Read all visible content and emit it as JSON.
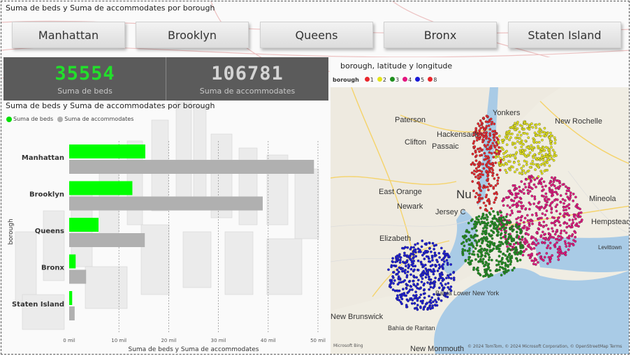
{
  "top_title": "Suma de beds y Suma de accommodates por borough",
  "slicer": {
    "items": [
      "Manhattan",
      "Brooklyn",
      "Queens",
      "Bronx",
      "Staten Island"
    ]
  },
  "kpis": [
    {
      "value": "35554",
      "label": "Suma de beds",
      "color": "#22e02b"
    },
    {
      "value": "106781",
      "label": "Suma de accommodates",
      "color": "#d0d0d0"
    }
  ],
  "bar_chart": {
    "title": "Suma de beds y Suma de accommodates por borough",
    "legend": [
      "Suma de beds",
      "Suma de accommodates"
    ]
  },
  "chart_data": {
    "type": "bar",
    "orientation": "horizontal",
    "title": "Suma de beds y Suma de accommodates por borough",
    "categories": [
      "Manhattan",
      "Brooklyn",
      "Queens",
      "Bronx",
      "Staten Island"
    ],
    "series": [
      {
        "name": "Suma de beds",
        "color": "#00ff00",
        "values": [
          15300,
          12700,
          5900,
          1300,
          600
        ]
      },
      {
        "name": "Suma de accommodates",
        "color": "#b0b0b0",
        "values": [
          49200,
          38900,
          15200,
          3400,
          1100
        ]
      }
    ],
    "xlabel": "Suma de beds y Suma de accommodates",
    "ylabel": "borough",
    "xlim": [
      0,
      50000
    ],
    "ticks": [
      0,
      10000,
      20000,
      30000,
      40000,
      50000
    ],
    "tick_labels": [
      "0 mil",
      "10 mil",
      "20 mil",
      "30 mil",
      "40 mil",
      "50 mil"
    ],
    "grid": true
  },
  "map": {
    "title": "borough, latitude y longitude",
    "legend_title": "borough",
    "legend": [
      {
        "label": "1",
        "color": "#e8262c"
      },
      {
        "label": "2",
        "color": "#e4e41a"
      },
      {
        "label": "3",
        "color": "#1f8f1f"
      },
      {
        "label": "4",
        "color": "#e3157f"
      },
      {
        "label": "5",
        "color": "#1a1ad6"
      },
      {
        "label": "8",
        "color": "#e8262c"
      }
    ],
    "places": [
      "Yonkers",
      "New Rochelle",
      "Paterson",
      "Hackensack",
      "Clifton",
      "Passaic",
      "East Orange",
      "Newark",
      "Jersey C",
      "Elizabeth",
      "Mineola",
      "Hempstead",
      "Levittown",
      "Bahía Lower New York",
      "Bahía de Raritan",
      "New Brunswick",
      "New Monmouth",
      "Nu"
    ],
    "attribution": "© 2024 TomTom, © 2024 Microsoft Corporation, © OpenStreetMap  Terms",
    "bing": "Microsoft Bing"
  }
}
